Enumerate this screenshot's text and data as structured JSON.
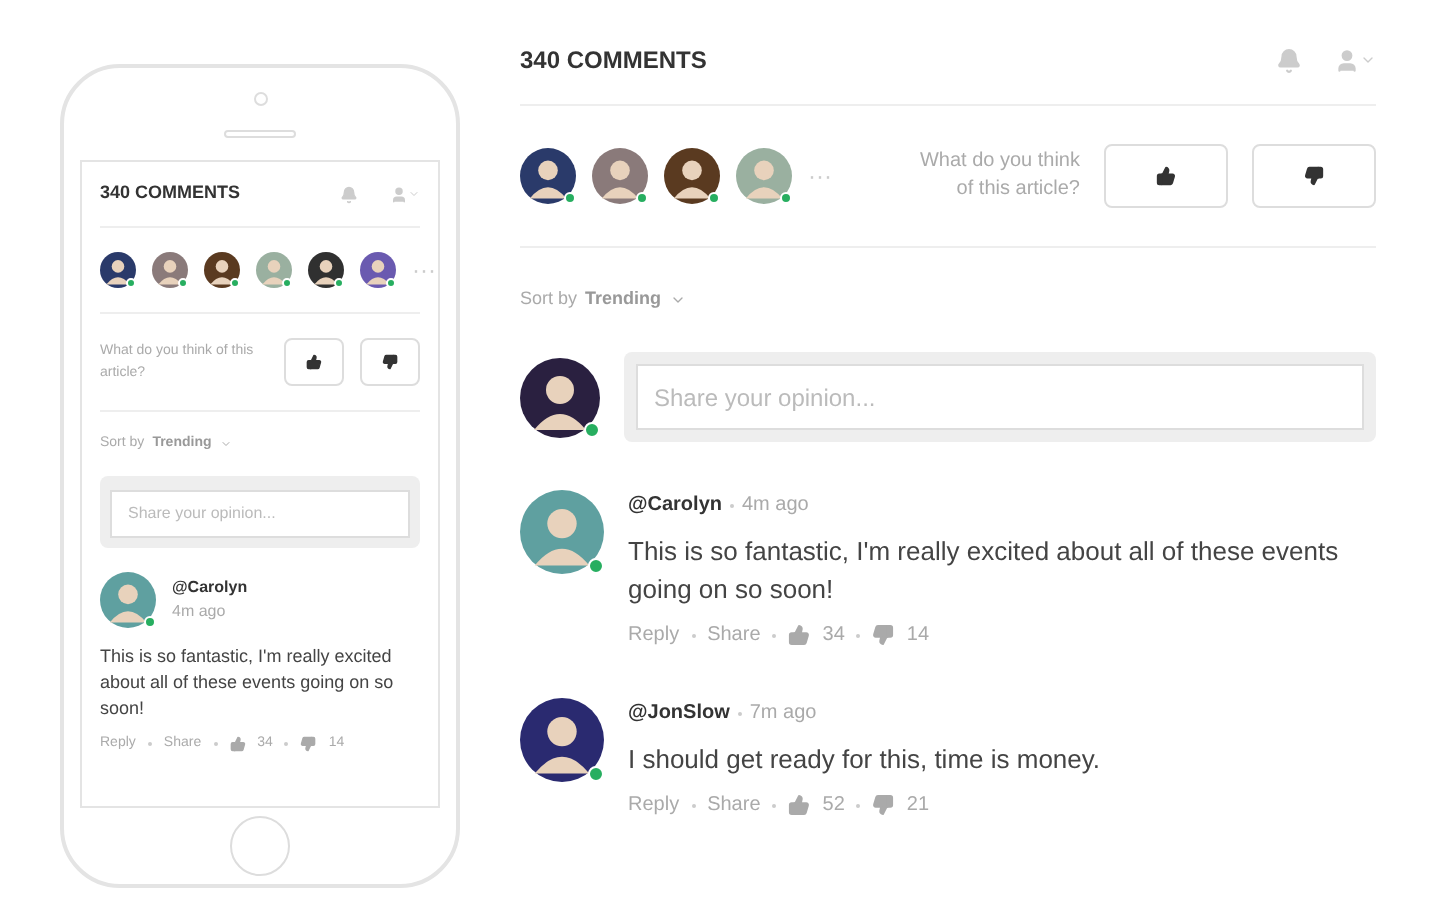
{
  "phone": {
    "title": "340 COMMENTS",
    "avatars": [
      {
        "color": "#2a3a6a",
        "online": true
      },
      {
        "color": "#8a7a7a",
        "online": true
      },
      {
        "color": "#5a3a20",
        "online": true
      },
      {
        "color": "#9ab0a0",
        "online": true
      },
      {
        "color": "#303030",
        "online": true
      },
      {
        "color": "#6a5ab0",
        "online": true
      }
    ],
    "more": "···",
    "question": "What do you think of this article?",
    "sort_label": "Sort by",
    "sort_value": "Trending",
    "placeholder": "Share your opinion...",
    "comments": [
      {
        "user": "@Carolyn",
        "time": "4m ago",
        "text": "This is so fantastic, I'm really excited about all of these events going on so soon!",
        "color": "#5fa0a0",
        "online": true,
        "reply": "Reply",
        "share": "Share",
        "likes": "34",
        "dislikes": "14"
      }
    ]
  },
  "main": {
    "title": "340 COMMENTS",
    "avatars": [
      {
        "color": "#2a3a6a",
        "online": true
      },
      {
        "color": "#8a7a7a",
        "online": true
      },
      {
        "color": "#5a3a20",
        "online": true
      },
      {
        "color": "#9ab0a0",
        "online": true
      }
    ],
    "more": "···",
    "question": "What do you think of this article?",
    "sort_label": "Sort by",
    "sort_value": "Trending",
    "placeholder": "Share your opinion...",
    "composer_avatar": {
      "color": "#2a2040",
      "online": true
    },
    "comments": [
      {
        "user": "@Carolyn",
        "time": "4m ago",
        "text": "This is so fantastic, I'm really excited about all of these events going on so soon!",
        "color": "#5fa0a0",
        "online": true,
        "reply": "Reply",
        "share": "Share",
        "likes": "34",
        "dislikes": "14"
      },
      {
        "user": "@JonSlow",
        "time": "7m ago",
        "text": "I should get ready for this, time is money.",
        "color": "#2a2a70",
        "online": true,
        "reply": "Reply",
        "share": "Share",
        "likes": "52",
        "dislikes": "21"
      }
    ]
  }
}
